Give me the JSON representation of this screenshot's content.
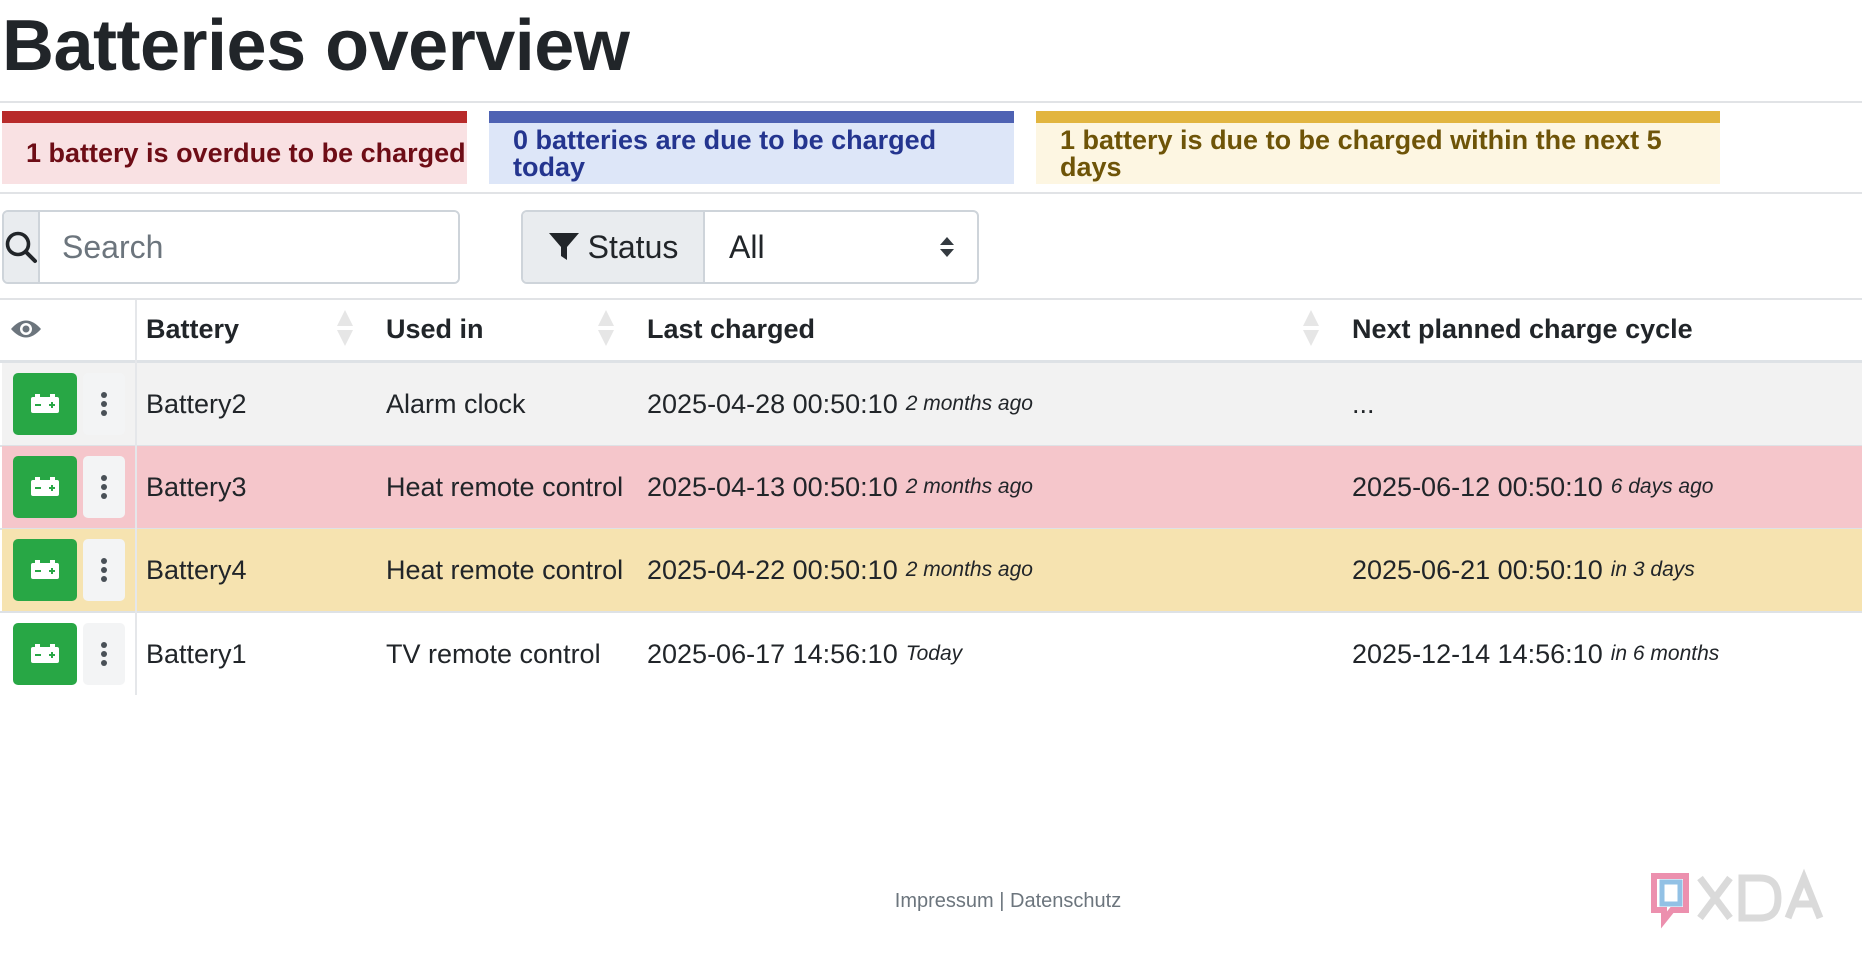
{
  "page": {
    "title": "Batteries overview"
  },
  "alerts": [
    {
      "text": "1 battery is overdue to be charged",
      "color": "#b82a2a"
    },
    {
      "text": "0 batteries are due to be charged today",
      "color": "#4e62b3"
    },
    {
      "text": "1 battery is due to be charged within the next 5 days",
      "color": "#e2b53f"
    }
  ],
  "filters": {
    "search_placeholder": "Search",
    "status_label": "Status",
    "status_value": "All"
  },
  "table": {
    "columns": [
      "Battery",
      "Used in",
      "Last charged",
      "Next planned charge cycle"
    ],
    "rows": [
      {
        "battery": "Battery2",
        "used_in": "Alarm clock",
        "last_charged": "2025-04-28 00:50:10",
        "last_charged_rel": "2 months ago",
        "next_charge": "...",
        "next_charge_rel": "",
        "status": "normal",
        "bg": "#f2f2f2"
      },
      {
        "battery": "Battery3",
        "used_in": "Heat remote control",
        "last_charged": "2025-04-13 00:50:10",
        "last_charged_rel": "2 months ago",
        "next_charge": "2025-06-12 00:50:10",
        "next_charge_rel": "6 days ago",
        "status": "overdue",
        "bg": "#f5c6cb"
      },
      {
        "battery": "Battery4",
        "used_in": "Heat remote control",
        "last_charged": "2025-04-22 00:50:10",
        "last_charged_rel": "2 months ago",
        "next_charge": "2025-06-21 00:50:10",
        "next_charge_rel": "in 3 days",
        "status": "due-soon",
        "bg": "#f6e3b0"
      },
      {
        "battery": "Battery1",
        "used_in": "TV remote control",
        "last_charged": "2025-06-17 14:56:10",
        "last_charged_rel": "Today",
        "next_charge": "2025-12-14 14:56:10",
        "next_charge_rel": "in 6 months",
        "status": "normal",
        "bg": "#ffffff"
      }
    ]
  },
  "footer": {
    "impressum": "Impressum",
    "separator": "|",
    "datenschutz": "Datenschutz"
  },
  "icons": {
    "search": "search-icon",
    "filter": "filter-icon",
    "select_arrows": "select-arrows-icon",
    "visibility": "eye-icon",
    "sort": "sort-icon",
    "charge": "battery-charge-icon",
    "more": "more-vertical-icon",
    "watermark": "xda-logo"
  },
  "colors": {
    "action_green": "#28a745",
    "overdue_row": "#f5c6cb",
    "due_soon_row": "#f6e3b0"
  }
}
